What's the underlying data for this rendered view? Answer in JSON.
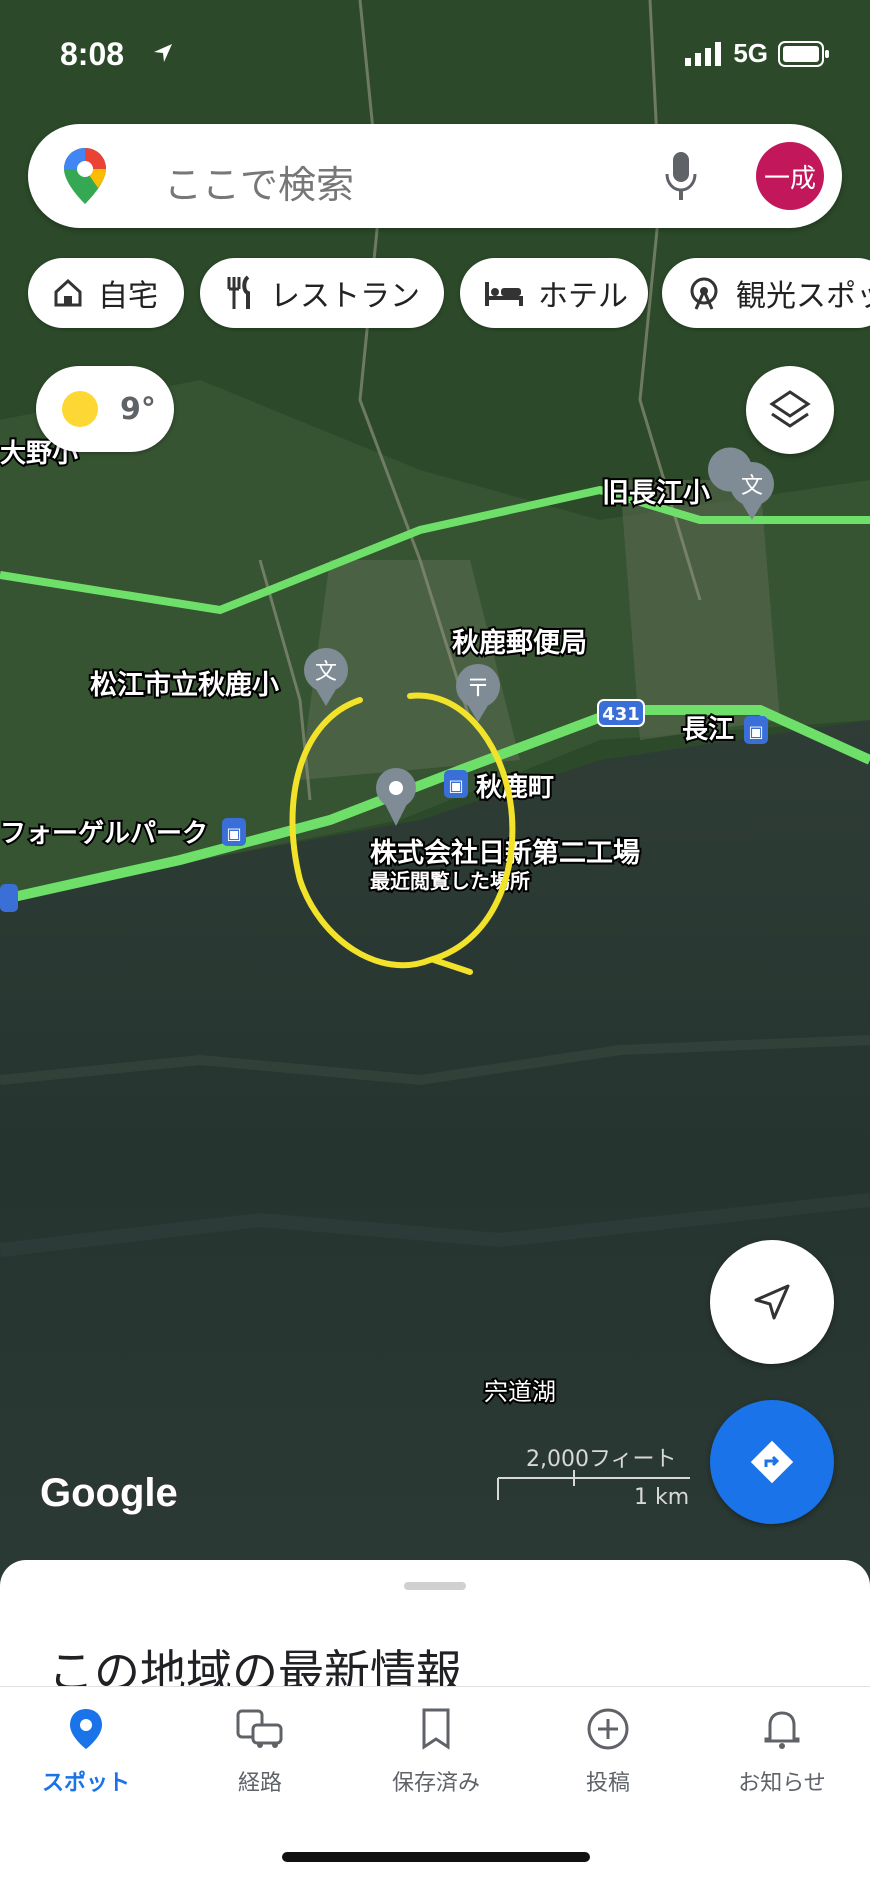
{
  "status_bar": {
    "time": "8:08",
    "network": "5G"
  },
  "search": {
    "placeholder": "ここで検索",
    "avatar_text": "一成"
  },
  "chips": [
    {
      "label": "自宅",
      "icon": "home-icon"
    },
    {
      "label": "レストラン",
      "icon": "restaurant-icon"
    },
    {
      "label": "ホテル",
      "icon": "hotel-icon"
    },
    {
      "label": "観光スポッ",
      "icon": "attraction-icon"
    }
  ],
  "weather": {
    "temp": "9°",
    "icon": "sun-icon"
  },
  "map": {
    "labels": {
      "oono": "大野小",
      "old_nagae": "旧長江小",
      "post_office": "秋鹿郵便局",
      "school": "松江市立秋鹿小",
      "route": "431",
      "nagae": "長江",
      "station": "秋鹿町",
      "vogel": "フォーゲルパーク",
      "place_name": "株式会社日新第二工場",
      "place_sub": "最近閲覧した場所",
      "lake": "宍道湖"
    },
    "scale": {
      "ft": "2,000フィート",
      "km": "1 km"
    },
    "logo": "Google",
    "annotation_color": "#f2e22a"
  },
  "sheet": {
    "title": "この地域の最新情報"
  },
  "nav": [
    {
      "label": "スポット",
      "icon": "place-pin-icon",
      "active": true
    },
    {
      "label": "経路",
      "icon": "commute-icon",
      "active": false
    },
    {
      "label": "保存済み",
      "icon": "bookmark-icon",
      "active": false
    },
    {
      "label": "投稿",
      "icon": "add-circle-icon",
      "active": false
    },
    {
      "label": "お知らせ",
      "icon": "bell-icon",
      "active": false
    }
  ],
  "colors": {
    "accent": "#1a73e8",
    "road": "#6ee06a",
    "avatar": "#c2185b"
  }
}
